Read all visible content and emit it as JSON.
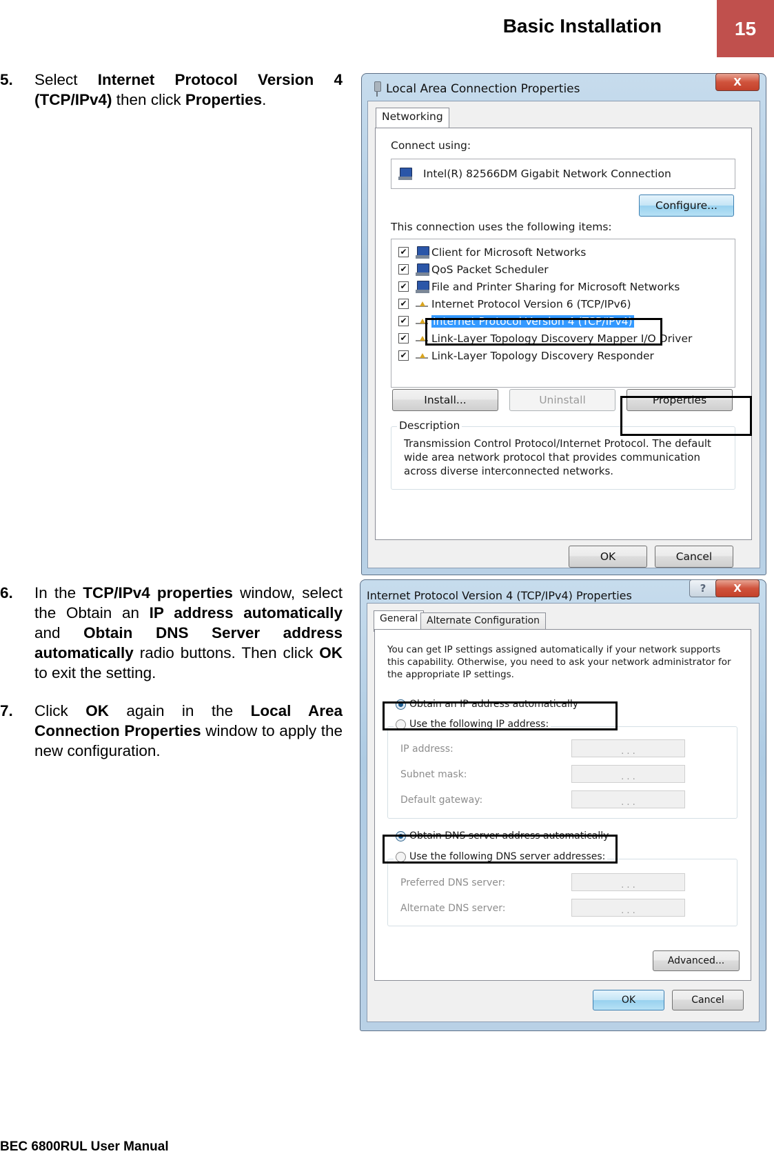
{
  "header": {
    "section_title": "Basic Installation",
    "page_number": "15",
    "accent_color": "#c0504d"
  },
  "footer": {
    "text": "BEC 6800RUL User Manual"
  },
  "steps": [
    {
      "number": "5.",
      "parts": [
        {
          "t": "Select ",
          "b": false
        },
        {
          "t": "Internet Protocol Version 4 (TCP/IPv4)",
          "b": true
        },
        {
          "t": " then click ",
          "b": false
        },
        {
          "t": "Properties",
          "b": true
        },
        {
          "t": ".",
          "b": false
        }
      ]
    },
    {
      "number": "6.",
      "parts": [
        {
          "t": "In the ",
          "b": false
        },
        {
          "t": "TCP/IPv4 properties",
          "b": true
        },
        {
          "t": " window, select the Obtain an ",
          "b": false
        },
        {
          "t": "IP address automatically",
          "b": true
        },
        {
          "t": " and ",
          "b": false
        },
        {
          "t": "Obtain DNS Server address automatically",
          "b": true
        },
        {
          "t": " radio buttons. Then click ",
          "b": false
        },
        {
          "t": "OK",
          "b": true
        },
        {
          "t": " to exit the setting.",
          "b": false
        }
      ]
    },
    {
      "number": "7.",
      "parts": [
        {
          "t": "Click ",
          "b": false
        },
        {
          "t": "OK",
          "b": true
        },
        {
          "t": " again in the ",
          "b": false
        },
        {
          "t": "Local Area Connection Properties",
          "b": true
        },
        {
          "t": " window to apply the new configuration.",
          "b": false
        }
      ]
    }
  ],
  "lan_dialog": {
    "title": "Local Area Connection Properties",
    "close_label": "X",
    "tab": "Networking",
    "connect_using_label": "Connect using:",
    "adapter_name": "Intel(R) 82566DM Gigabit Network Connection",
    "configure_button": "Configure...",
    "items_label": "This connection uses the following items:",
    "items": [
      {
        "label": "Client for Microsoft Networks",
        "checked": true,
        "icon": "network-client-icon",
        "selected": false
      },
      {
        "label": "QoS Packet Scheduler",
        "checked": true,
        "icon": "computer-icon",
        "selected": false
      },
      {
        "label": "File and Printer Sharing for Microsoft Networks",
        "checked": true,
        "icon": "computer-icon",
        "selected": false
      },
      {
        "label": "Internet Protocol Version 6 (TCP/IPv6)",
        "checked": true,
        "icon": "protocol-icon",
        "selected": false
      },
      {
        "label": "Internet Protocol Version 4 (TCP/IPv4)",
        "checked": true,
        "icon": "protocol-icon",
        "selected": true
      },
      {
        "label": "Link-Layer Topology Discovery Mapper I/O Driver",
        "checked": true,
        "icon": "protocol-icon",
        "selected": false
      },
      {
        "label": "Link-Layer Topology Discovery Responder",
        "checked": true,
        "icon": "protocol-icon",
        "selected": false
      }
    ],
    "install_button": "Install...",
    "uninstall_button": "Uninstall",
    "properties_button": "Properties",
    "description_label": "Description",
    "description_text": "Transmission Control Protocol/Internet Protocol. The default wide area network protocol that provides communication across diverse interconnected networks.",
    "ok_button": "OK",
    "cancel_button": "Cancel"
  },
  "ipv4_dialog": {
    "title": "Internet Protocol Version 4 (TCP/IPv4) Properties",
    "help_label": "?",
    "close_label": "X",
    "tabs": [
      "General",
      "Alternate Configuration"
    ],
    "intro_text": "You can get IP settings assigned automatically if your network supports this capability. Otherwise, you need to ask your network administrator for the appropriate IP settings.",
    "ip_auto_label": "Obtain an IP address automatically",
    "ip_manual_label": "Use the following IP address:",
    "ip_auto_selected": true,
    "ip_fields": [
      {
        "label": "IP address:",
        "value": ". . ."
      },
      {
        "label": "Subnet mask:",
        "value": ". . ."
      },
      {
        "label": "Default gateway:",
        "value": ". . ."
      }
    ],
    "dns_auto_label": "Obtain DNS server address automatically",
    "dns_manual_label": "Use the following DNS server addresses:",
    "dns_auto_selected": true,
    "dns_fields": [
      {
        "label": "Preferred DNS server:",
        "value": ". . ."
      },
      {
        "label": "Alternate DNS server:",
        "value": ". . ."
      }
    ],
    "advanced_button": "Advanced...",
    "ok_button": "OK",
    "cancel_button": "Cancel"
  }
}
